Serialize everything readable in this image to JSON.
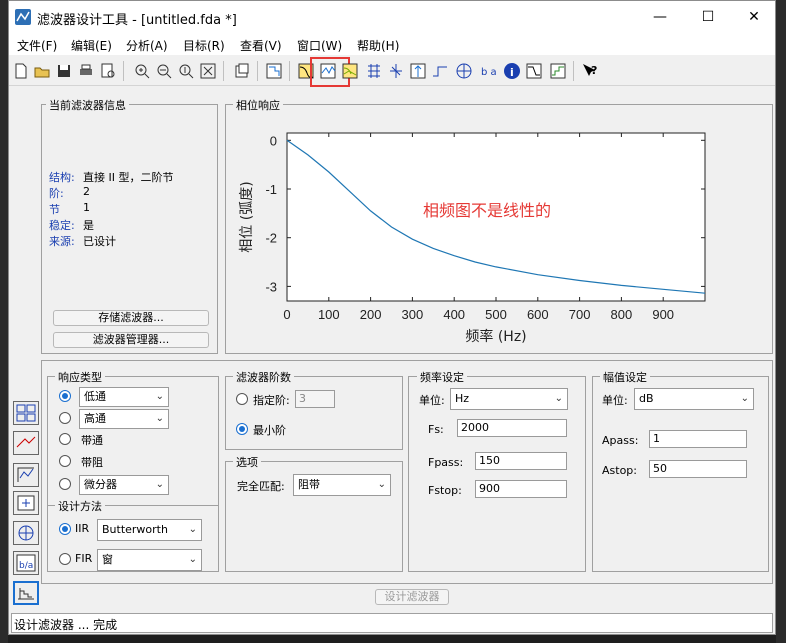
{
  "window": {
    "title": "滤波器设计工具 - [untitled.fda *]"
  },
  "menu": [
    "文件(F)",
    "编辑(E)",
    "分析(A)",
    "目标(R)",
    "查看(V)",
    "窗口(W)",
    "帮助(H)"
  ],
  "info_panel": {
    "title": "当前滤波器信息",
    "rows": [
      {
        "label": "结构:",
        "value": "直接 II 型，二阶节"
      },
      {
        "label": "阶:",
        "value": "2"
      },
      {
        "label": "节",
        "value": "1"
      },
      {
        "label": "稳定:",
        "value": "是"
      },
      {
        "label": "来源:",
        "value": "已设计"
      }
    ],
    "store_button": "存储滤波器...",
    "manager_button": "滤波器管理器..."
  },
  "plot_panel": {
    "title": "相位响应",
    "annotation": "相频图不是线性的"
  },
  "chart_data": {
    "type": "line",
    "xlabel": "频率 (Hz)",
    "ylabel": "相位 (弧度)",
    "xlim": [
      0,
      1000
    ],
    "ylim": [
      -3.3,
      0.15
    ],
    "xticks": [
      0,
      100,
      200,
      300,
      400,
      500,
      600,
      700,
      800,
      900
    ],
    "yticks": [
      0,
      -1,
      -2,
      -3
    ],
    "x": [
      0,
      50,
      100,
      150,
      200,
      250,
      300,
      350,
      400,
      450,
      500,
      600,
      700,
      800,
      900,
      1000
    ],
    "y": [
      0,
      -0.3,
      -0.65,
      -1.05,
      -1.45,
      -1.78,
      -2.03,
      -2.22,
      -2.37,
      -2.5,
      -2.6,
      -2.76,
      -2.88,
      -2.98,
      -3.06,
      -3.14
    ],
    "color": "#1f77b4"
  },
  "response_type": {
    "title": "响应类型",
    "lowpass": "低通",
    "highpass": "高通",
    "bandpass": "带通",
    "bandstop": "带阻",
    "differentiator": "微分器"
  },
  "design_method": {
    "title": "设计方法",
    "iir": "IIR",
    "iir_value": "Butterworth",
    "fir": "FIR",
    "fir_value": "窗"
  },
  "order": {
    "title": "滤波器阶数",
    "specify": "指定阶:",
    "specify_value": "3",
    "minimum": "最小阶"
  },
  "options": {
    "title": "选项",
    "match": "完全匹配:",
    "match_value": "阻带"
  },
  "freq": {
    "title": "频率设定",
    "unit_label": "单位:",
    "unit": "Hz",
    "fs_label": "Fs:",
    "fs": "2000",
    "fpass_label": "Fpass:",
    "fpass": "150",
    "fstop_label": "Fstop:",
    "fstop": "900"
  },
  "mag": {
    "title": "幅值设定",
    "unit_label": "单位:",
    "unit": "dB",
    "apass_label": "Apass:",
    "apass": "1",
    "astop_label": "Astop:",
    "astop": "50"
  },
  "design_button": "设计滤波器",
  "status": "设计滤波器 ... 完成",
  "accent": "#1a6fd0",
  "highlight": "#e53935",
  "annotation_color": "#e53935"
}
